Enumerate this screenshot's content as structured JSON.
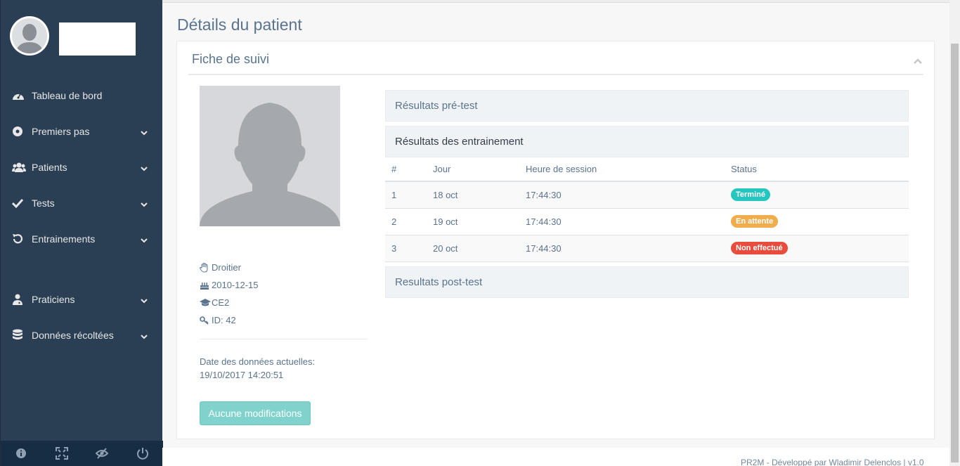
{
  "sidebar": {
    "menu": [
      {
        "label": "Tableau de bord",
        "icon": "dashboard-icon",
        "has_chevron": false
      },
      {
        "label": "Premiers pas",
        "icon": "compass-icon",
        "has_chevron": true
      },
      {
        "label": "Patients",
        "icon": "users-icon",
        "has_chevron": true
      },
      {
        "label": "Tests",
        "icon": "check-icon",
        "has_chevron": true
      },
      {
        "label": "Entrainements",
        "icon": "undo-icon",
        "has_chevron": true
      },
      {
        "label": "Praticiens",
        "icon": "user-md-icon",
        "has_chevron": true
      },
      {
        "label": "Données récoltées",
        "icon": "database-icon",
        "has_chevron": true
      }
    ],
    "footer_icons": [
      "info-icon",
      "fullscreen-icon",
      "eye-slash-icon",
      "power-icon"
    ]
  },
  "page": {
    "title": "Détails du patient"
  },
  "panel": {
    "title": "Fiche de suivi",
    "patient": {
      "handedness": "Droitier",
      "birthdate": "2010-12-15",
      "grade": "CE2",
      "id": "ID: 42"
    },
    "date_label": "Date des données actuelles:",
    "date_value": "19/10/2017 14:20:51",
    "button_label": "Aucune modifications"
  },
  "sections": {
    "pre_test": "Résultats pré-test",
    "training": "Résultats des entrainement",
    "post_test": "Resultats post-test"
  },
  "table": {
    "headers": [
      "#",
      "Jour",
      "Heure de session",
      "Status"
    ],
    "rows": [
      {
        "num": "1",
        "day": "18 oct",
        "time": "17:44:30",
        "status": "Terminé",
        "color": "#26c6c0"
      },
      {
        "num": "2",
        "day": "19 oct",
        "time": "17:44:30",
        "status": "En attente",
        "color": "#f0ad4e"
      },
      {
        "num": "3",
        "day": "20 oct",
        "time": "17:44:30",
        "status": "Non effectué",
        "color": "#e74c3c"
      }
    ]
  },
  "footer": {
    "credit": "PR2M - Développé par Wladimir Delenclos | v1.0"
  },
  "colors": {
    "sidebar_bg": "#2a3f54",
    "accent": "#26b99a",
    "button": "#7fd3cc"
  }
}
